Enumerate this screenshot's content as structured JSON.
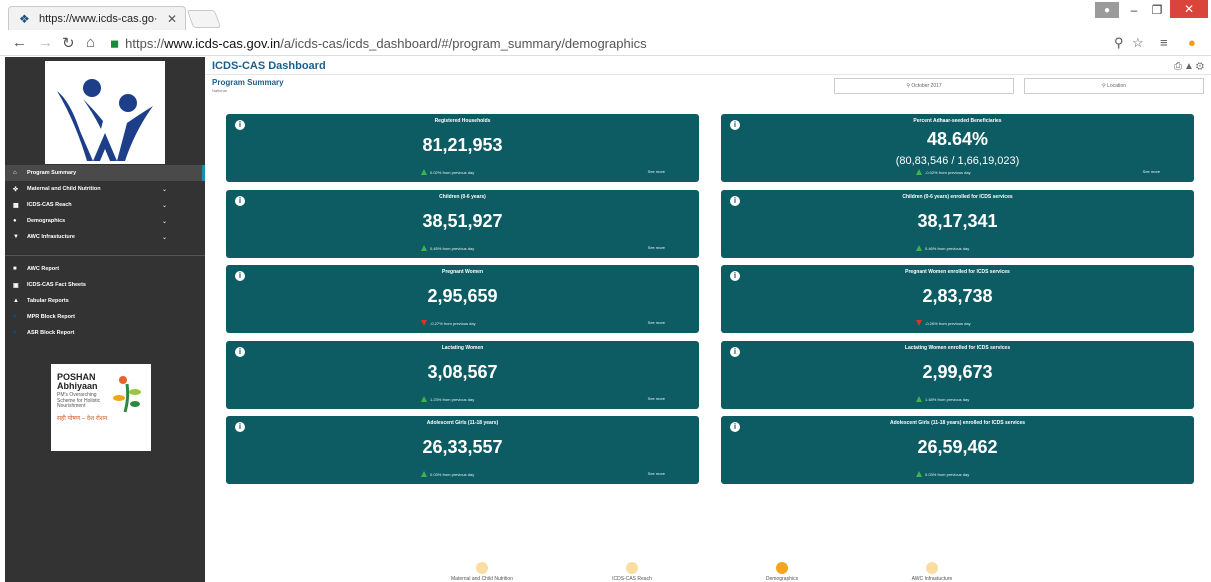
{
  "browser": {
    "tab_title": "https://www.icds-cas.go·",
    "url_secure": "https://",
    "url_host": "www.icds-cas.gov.in",
    "url_path": "/a/icds-cas/icds_dashboard/#/program_summary/demographics"
  },
  "app": {
    "title": "ICDS-CAS Dashboard",
    "page_title": "Program Summary",
    "page_subtitle": "National",
    "filters": {
      "date": "October 2017",
      "location": "Location"
    }
  },
  "sidebar": {
    "nav": [
      {
        "label": "Program Summary",
        "icon": "home-icon",
        "active": true,
        "chevron": false
      },
      {
        "label": "Maternal and Child Nutrition",
        "icon": "child-icon",
        "active": false,
        "chevron": true
      },
      {
        "label": "ICDS-CAS Reach",
        "icon": "chart-icon",
        "active": false,
        "chevron": true
      },
      {
        "label": "Demographics",
        "icon": "users-icon",
        "active": false,
        "chevron": true
      },
      {
        "label": "AWC Infrastucture",
        "icon": "location-pin-icon",
        "active": false,
        "chevron": true
      }
    ],
    "reports": [
      {
        "label": "AWC Report",
        "icon": "table-icon"
      },
      {
        "label": "ICDS-CAS Fact Sheets",
        "icon": "document-icon"
      },
      {
        "label": "Tabular Reports",
        "icon": "tabular-icon"
      },
      {
        "label": "MPR Block Report",
        "icon": "report-icon"
      },
      {
        "label": "ASR Block Report",
        "icon": "report-icon"
      }
    ],
    "poshan": {
      "line1": "POSHAN",
      "line2": "Abhiyaan",
      "tagline": "PM's Overarching Scheme for Holistic Nourishment",
      "hindi": "सही पोषण – देश रोशन"
    }
  },
  "cards": [
    {
      "title": "Registered Households",
      "value": "81,21,953",
      "sub": "",
      "change": "0.02% from previous day",
      "trend": "up",
      "see_more": "See more"
    },
    {
      "title": "Percent Adhaar-seeded Beneficiaries",
      "value": "48.64%",
      "sub": "(80,83,546 / 1,66,19,023)",
      "change": "-0.02% from previous day",
      "trend": "up",
      "see_more": "See more"
    },
    {
      "title": "Children (0-6 years)",
      "value": "38,51,927",
      "sub": "",
      "change": "0.45% from previous day",
      "trend": "up",
      "see_more": "See more"
    },
    {
      "title": "Children (0-6 years) enrolled for ICDS services",
      "value": "38,17,341",
      "sub": "",
      "change": "0.46% from previous day",
      "trend": "up",
      "see_more": ""
    },
    {
      "title": "Pregnant Women",
      "value": "2,95,659",
      "sub": "",
      "change": "-0.27% from previous day",
      "trend": "down",
      "see_more": "See more"
    },
    {
      "title": "Pregnant Women enrolled for ICDS services",
      "value": "2,83,738",
      "sub": "",
      "change": "-0.26% from previous day",
      "trend": "down",
      "see_more": ""
    },
    {
      "title": "Lactating Women",
      "value": "3,08,567",
      "sub": "",
      "change": "1.23% from previous day",
      "trend": "up",
      "see_more": "See more"
    },
    {
      "title": "Lactating Women enrolled for ICDS services",
      "value": "2,99,673",
      "sub": "",
      "change": "1.48% from previous day",
      "trend": "up",
      "see_more": ""
    },
    {
      "title": "Adolescent Girls (11-18 years)",
      "value": "26,33,557",
      "sub": "",
      "change": "0.03% from previous day",
      "trend": "up",
      "see_more": "See more"
    },
    {
      "title": "Adolescent Girls (11-18 years) enrolled for ICDS services",
      "value": "26,59,462",
      "sub": "",
      "change": "0.03% from previous day",
      "trend": "up",
      "see_more": ""
    }
  ],
  "bottom_tabs": [
    {
      "label": "Maternal and Child Nutrition",
      "active": false
    },
    {
      "label": "ICDS-CAS Reach",
      "active": false
    },
    {
      "label": "Demographics",
      "active": true
    },
    {
      "label": "AWC Infrastucture",
      "active": false
    }
  ],
  "colors": {
    "card": "#0e5c63",
    "sidebar": "#333333",
    "accent": "#f5a41f",
    "title": "#1b5e8c"
  }
}
